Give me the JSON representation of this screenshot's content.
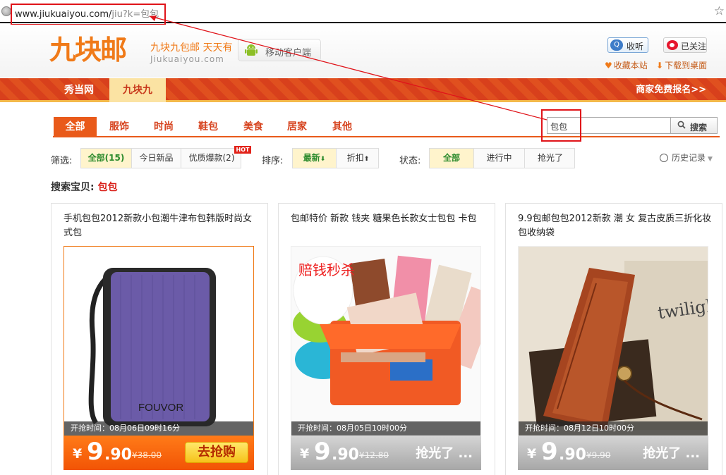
{
  "address_bar": {
    "url_host": "www.jiukuaiyou.com/",
    "url_path": "jiu?k=",
    "url_query": "包包"
  },
  "header": {
    "logo": "九块邮",
    "slogan": "九块九包邮 天天有",
    "slogan_en": "Jiukuaiyou.com",
    "mobile_client": "移动客户端",
    "listen": "收听",
    "follow": "已关注",
    "bookmark": "收藏本站",
    "download": "下载到桌面"
  },
  "nav": {
    "tabs": [
      {
        "label": "秀当网"
      },
      {
        "label": "九块九"
      }
    ],
    "merchant": "商家免费报名>>"
  },
  "categories": [
    "全部",
    "服饰",
    "时尚",
    "鞋包",
    "美食",
    "居家",
    "其他"
  ],
  "search": {
    "value": "包包",
    "button": "搜索"
  },
  "filters": {
    "filter_label": "筛选:",
    "filter_items": [
      "全部(15)",
      "今日新品",
      "优质爆款(2)"
    ],
    "hot_badge": "HOT",
    "sort_label": "排序:",
    "sort_items": [
      "最新",
      "折扣"
    ],
    "status_label": "状态:",
    "status_items": [
      "全部",
      "进行中",
      "抢光了"
    ],
    "history": "历史记录"
  },
  "search_result": {
    "label": "搜索宝贝:",
    "keyword": "包包"
  },
  "products": [
    {
      "title": "手机包包2012新款小包潮牛津布包韩版时尚女式包",
      "time": "开抢时间：08月06日09时16分",
      "yen": "¥",
      "price_int": "9",
      "price_dec": ".90",
      "old_price": "¥38.00",
      "action": "去抢购",
      "brand_text": "FOUVOR"
    },
    {
      "title": "包邮特价 新款 钱夹 糖果色长款女士包包 卡包",
      "time": "开抢时间：08月05日10时00分",
      "yen": "¥",
      "price_int": "9",
      "price_dec": ".90",
      "old_price": "¥12.80",
      "action": "抢光了 ...",
      "stamp_text": "赔钱秒杀"
    },
    {
      "title": "9.9包邮包包2012新款 潮 女 复古皮质三折化妆包收纳袋",
      "time": "开抢时间：08月12日10时00分",
      "yen": "¥",
      "price_int": "9",
      "price_dec": ".90",
      "old_price": "¥9.90",
      "action": "抢光了 ...",
      "book_text": "twilight"
    }
  ],
  "colors": {
    "brand_orange": "#f07a18",
    "nav_red": "#d8401c",
    "annotation_red": "#e0141a"
  }
}
